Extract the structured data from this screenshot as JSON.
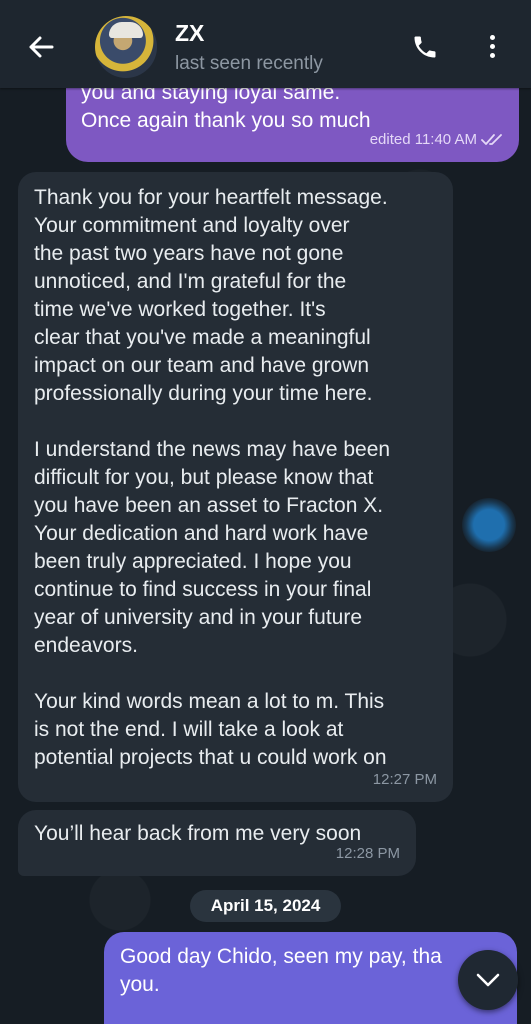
{
  "header": {
    "contact_name": "ZX",
    "status": "last seen recently"
  },
  "messages": {
    "outgoing_top": {
      "lines": [
        "you and staying loyal same.",
        "Once again thank you so much"
      ],
      "meta": "edited 11:40 AM"
    },
    "incoming_long": {
      "paragraphs": [
        "Thank you for your heartfelt message.\nYour commitment and loyalty over\nthe past two years have not gone\nunnoticed, and I'm grateful for the\ntime we've worked together. It's\nclear that you've made a meaningful\nimpact on our team and have grown\nprofessionally during your time here.",
        "I understand the news may have been\ndifficult for you, but please know that\nyou have been an asset to Fracton X.\nYour dedication and hard work have\nbeen truly appreciated. I hope you\ncontinue to find success in your final\nyear of university and in your future\nendeavors.",
        "Your kind words mean a lot to m. This\nis not the end. I will take a look at\npotential projects that u could work on"
      ],
      "time": "12:27 PM"
    },
    "incoming_short": {
      "text": "You’ll hear back from me very soon",
      "time": "12:28 PM"
    },
    "date_separator": "April 15, 2024",
    "outgoing_bottom": {
      "text": "Good day Chido, seen my pay, tha\nyou."
    }
  },
  "icons": {
    "back": "arrow-left-icon",
    "call": "phone-icon",
    "menu": "more-vertical-icon",
    "read": "double-check-icon",
    "scroll": "chevron-down-icon"
  },
  "colors": {
    "outgoing_top": "#7e58c2",
    "outgoing_bottom": "#6b63d8",
    "incoming": "#252d36",
    "header": "#1e262f"
  }
}
